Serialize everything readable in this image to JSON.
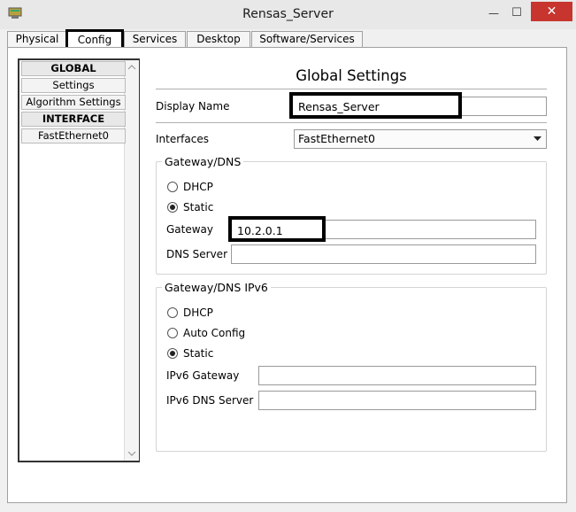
{
  "window": {
    "title": "Rensas_Server",
    "close_glyph": "✕",
    "min_glyph": "—",
    "max_glyph": "☐"
  },
  "tabs": [
    {
      "label": "Physical"
    },
    {
      "label": "Config"
    },
    {
      "label": "Services"
    },
    {
      "label": "Desktop"
    },
    {
      "label": "Software/Services"
    }
  ],
  "active_tab": "Config",
  "sidebar": {
    "items": [
      {
        "label": "GLOBAL",
        "header": true
      },
      {
        "label": "Settings"
      },
      {
        "label": "Algorithm Settings"
      },
      {
        "label": "INTERFACE",
        "header": true
      },
      {
        "label": "FastEthernet0"
      }
    ]
  },
  "main": {
    "heading": "Global Settings",
    "display_name_label": "Display Name",
    "display_name_value": "Rensas_Server",
    "interfaces_label": "Interfaces",
    "interfaces_value": "FastEthernet0",
    "gateway_dns": {
      "title": "Gateway/DNS",
      "dhcp_label": "DHCP",
      "static_label": "Static",
      "selected": "Static",
      "gateway_label": "Gateway",
      "gateway_value": "10.2.0.1",
      "dns_label": "DNS Server",
      "dns_value": ""
    },
    "gateway_dns_ipv6": {
      "title": "Gateway/DNS IPv6",
      "dhcp_label": "DHCP",
      "auto_label": "Auto Config",
      "static_label": "Static",
      "selected": "Static",
      "gateway_label": "IPv6 Gateway",
      "gateway_value": "",
      "dns_label": "IPv6 DNS Server",
      "dns_value": ""
    }
  },
  "icons": {
    "app": "packet-tracer-server-icon",
    "dropdown": "chevron-down-icon"
  },
  "colors": {
    "close_button": "#c7352e",
    "highlight_border": "#000000"
  }
}
